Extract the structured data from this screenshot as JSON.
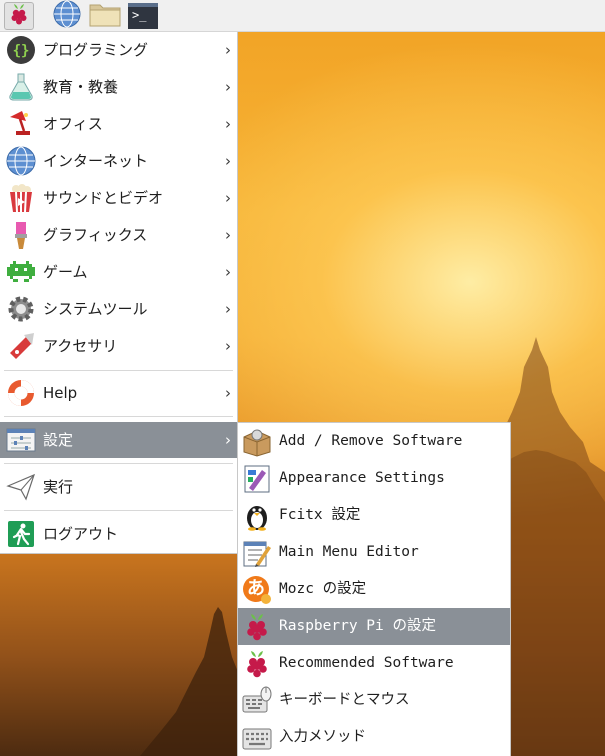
{
  "panel": {
    "buttons": [
      {
        "icon": "raspberry-icon"
      },
      {
        "icon": "web-browser-icon"
      },
      {
        "icon": "file-manager-icon"
      },
      {
        "icon": "terminal-icon",
        "glyph": ">_"
      }
    ]
  },
  "main_menu": {
    "items": [
      {
        "label": "プログラミング",
        "icon": "programming-icon",
        "arrow": "›"
      },
      {
        "label": "教育・教養",
        "icon": "education-icon",
        "arrow": "›"
      },
      {
        "label": "オフィス",
        "icon": "office-icon",
        "arrow": "›"
      },
      {
        "label": "インターネット",
        "icon": "internet-icon",
        "arrow": "›"
      },
      {
        "label": "サウンドとビデオ",
        "icon": "sound-video-icon",
        "arrow": "›"
      },
      {
        "label": "グラフィックス",
        "icon": "graphics-icon",
        "arrow": "›"
      },
      {
        "label": "ゲーム",
        "icon": "games-icon",
        "arrow": "›"
      },
      {
        "label": "システムツール",
        "icon": "system-tools-icon",
        "arrow": "›"
      },
      {
        "label": "アクセサリ",
        "icon": "accessories-icon",
        "arrow": "›"
      },
      {
        "label": "Help",
        "icon": "help-icon",
        "arrow": "›"
      },
      {
        "label": "設定",
        "icon": "settings-icon",
        "arrow": "›",
        "active": true
      },
      {
        "label": "実行",
        "icon": "run-icon"
      },
      {
        "label": "ログアウト",
        "icon": "logout-icon"
      }
    ]
  },
  "sub_menu": {
    "items": [
      {
        "label": "Add / Remove Software",
        "icon": "package-icon"
      },
      {
        "label": "Appearance Settings",
        "icon": "appearance-icon"
      },
      {
        "label": "Fcitx 設定",
        "icon": "penguin-icon"
      },
      {
        "label": "Main Menu Editor",
        "icon": "menu-editor-icon"
      },
      {
        "label": "Mozc の設定",
        "icon": "mozc-icon",
        "glyph": "あ"
      },
      {
        "label": "Raspberry Pi の設定",
        "icon": "raspberry-icon",
        "active": true
      },
      {
        "label": "Recommended Software",
        "icon": "raspberry-icon"
      },
      {
        "label": "キーボードとマウス",
        "icon": "keyboard-mouse-icon"
      },
      {
        "label": "入力メソッド",
        "icon": "keyboard-icon"
      }
    ]
  },
  "colors": {
    "highlight": "#8a9097",
    "menu_bg": "#ffffff",
    "panel_bg": "#f0f0f0",
    "raspberry": "#c51a4a",
    "leaf": "#6cc04a"
  }
}
